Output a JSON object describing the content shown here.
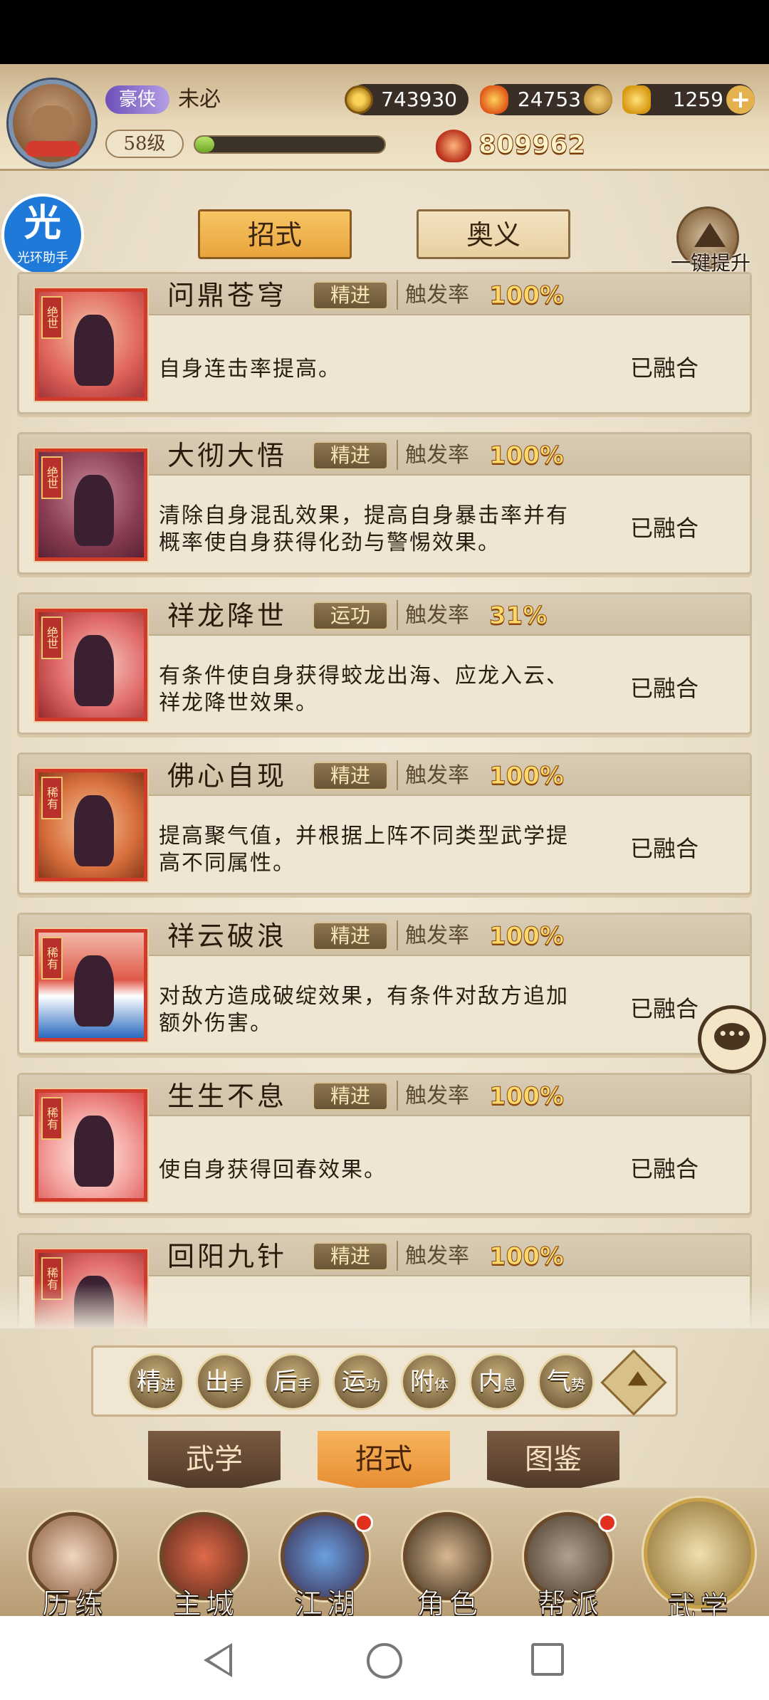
{
  "player": {
    "vip_label": "豪侠",
    "name": "未必",
    "level": "58级",
    "exp_fraction": 0.1
  },
  "resources": {
    "coins": "743930",
    "currency2": "24753",
    "gold": "1259",
    "power": "809962"
  },
  "helper_badge": {
    "big": "光",
    "small": "光环助手"
  },
  "top_tabs": {
    "active": "招式",
    "other": "奥义"
  },
  "upgrade_label": "一键提升",
  "rate_label": "触发率",
  "skills": [
    {
      "name": "问鼎苍穹",
      "tag": "绝世",
      "grade": "精进",
      "rate": "100%",
      "desc": "自身连击率提高。",
      "status": "已融合",
      "icon": "warrior-silhouette-icon"
    },
    {
      "name": "大彻大悟",
      "tag": "绝世",
      "grade": "精进",
      "rate": "100%",
      "desc": "清除自身混乱效果，提高自身暴击率并有概率使自身获得化劲与警惕效果。",
      "status": "已融合",
      "icon": "meditating-figure-icon"
    },
    {
      "name": "祥龙降世",
      "tag": "绝世",
      "grade": "运功",
      "rate": "31%",
      "desc": "有条件使自身获得蛟龙出海、应龙入云、祥龙降世效果。",
      "status": "已融合",
      "icon": "dragon-icon"
    },
    {
      "name": "佛心自现",
      "tag": "稀有",
      "grade": "精进",
      "rate": "100%",
      "desc": "提高聚气值，并根据上阵不同类型武学提高不同属性。",
      "status": "已融合",
      "icon": "prayer-hands-icon"
    },
    {
      "name": "祥云破浪",
      "tag": "稀有",
      "grade": "精进",
      "rate": "100%",
      "desc": "对敌方造成破绽效果，有条件对敌方追加额外伤害。",
      "status": "已融合",
      "icon": "wave-icon"
    },
    {
      "name": "生生不息",
      "tag": "稀有",
      "grade": "精进",
      "rate": "100%",
      "desc": "使自身获得回春效果。",
      "status": "已融合",
      "icon": "flame-icon"
    },
    {
      "name": "回阳九针",
      "tag": "稀有",
      "grade": "精进",
      "rate": "100%",
      "desc": "",
      "status": "",
      "icon": "needle-icon"
    }
  ],
  "filters": [
    {
      "big": "精",
      "small": "进"
    },
    {
      "big": "出",
      "small": "手"
    },
    {
      "big": "后",
      "small": "手"
    },
    {
      "big": "运",
      "small": "功"
    },
    {
      "big": "附",
      "small": "体"
    },
    {
      "big": "内",
      "small": "息"
    },
    {
      "big": "气",
      "small": "势"
    }
  ],
  "bottom_tabs": [
    "武学",
    "招式",
    "图鉴"
  ],
  "nav": [
    "历练",
    "主城",
    "江湖",
    "角色",
    "帮派",
    "武学"
  ],
  "chat_icon": "chat-bubble-icon"
}
